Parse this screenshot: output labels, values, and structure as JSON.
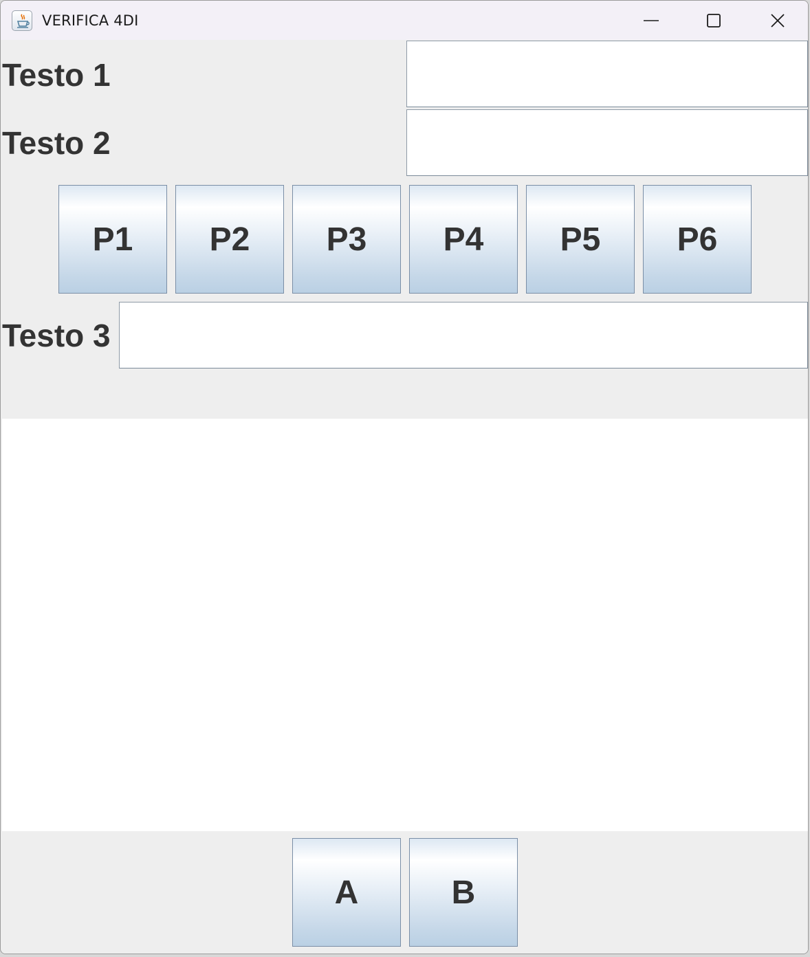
{
  "window": {
    "title": "VERIFICA 4DI",
    "icon": "java-cup-icon",
    "controls": [
      "minimize-icon",
      "maximize-icon",
      "close-icon"
    ]
  },
  "form": {
    "label_1": "Testo 1",
    "field_1_value": "",
    "label_2": "Testo 2",
    "field_2_value": "",
    "buttons": [
      "P1",
      "P2",
      "P3",
      "P4",
      "P5",
      "P6"
    ],
    "label_3": "Testo 3",
    "field_3_value": ""
  },
  "text_area": {
    "value": ""
  },
  "bottom_buttons": [
    "A",
    "B"
  ],
  "colors": {
    "panel_bg": "#eeeeee",
    "titlebar_bg": "#f3f0f7",
    "label_text": "#333333",
    "button_border": "#7a8ea6",
    "button_gradient_top": "#ffffff",
    "button_gradient_bottom": "#bad0e4"
  }
}
